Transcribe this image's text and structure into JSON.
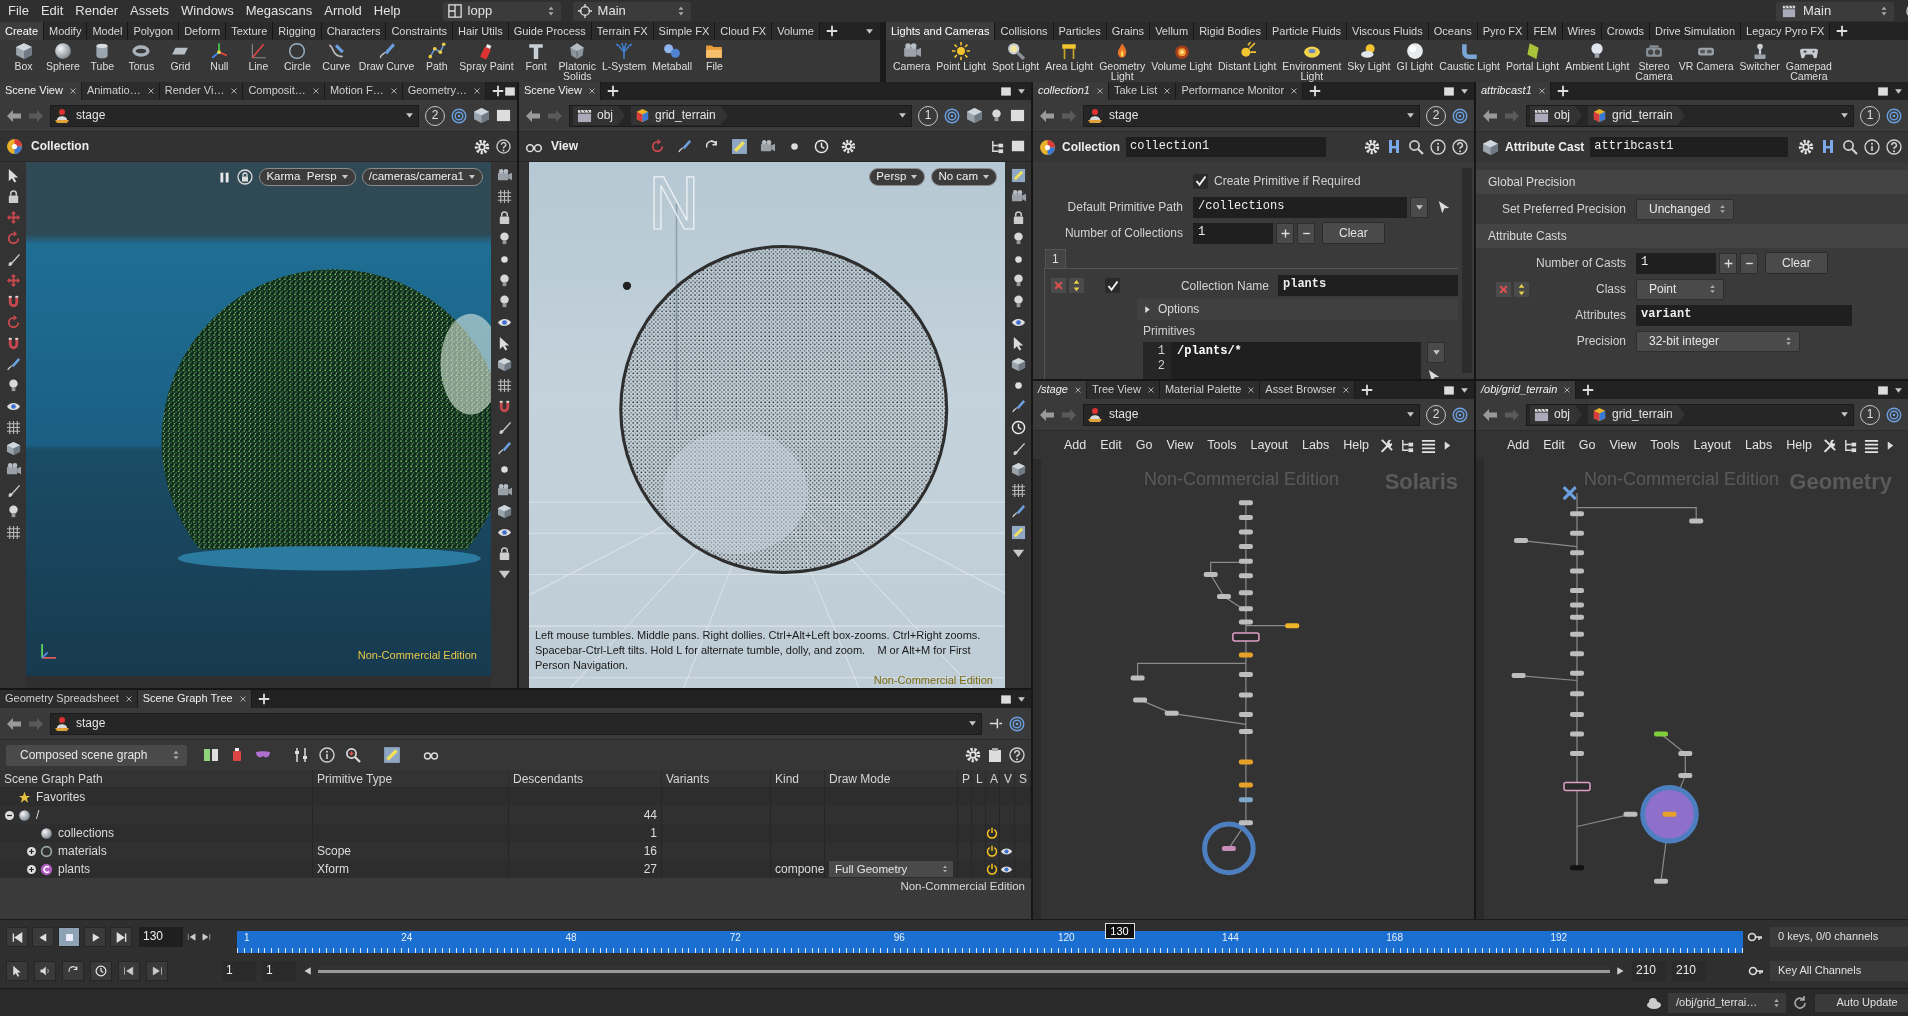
{
  "menu_bar": {
    "menus": [
      "File",
      "Edit",
      "Render",
      "Assets",
      "Windows",
      "Megascans",
      "Arnold",
      "Help"
    ],
    "desktop": "lopp",
    "context": "Main",
    "right_desktop": "Main"
  },
  "shelves": [
    {
      "tabs": [
        {
          "label": "Create",
          "selected": true
        },
        {
          "label": "Modify",
          "selected": false
        },
        {
          "label": "Model",
          "selected": false
        },
        {
          "label": "Polygon",
          "selected": false
        },
        {
          "label": "Deform",
          "selected": false
        },
        {
          "label": "Texture",
          "selected": false
        },
        {
          "label": "Rigging",
          "selected": false
        },
        {
          "label": "Characters",
          "selected": false
        },
        {
          "label": "Constraints",
          "selected": false
        },
        {
          "label": "Hair Utils",
          "selected": false
        },
        {
          "label": "Guide Process",
          "selected": false
        },
        {
          "label": "Terrain FX",
          "selected": false
        },
        {
          "label": "Simple FX",
          "selected": false
        },
        {
          "label": "Cloud FX",
          "selected": false
        },
        {
          "label": "Volume",
          "selected": false
        }
      ],
      "tools": [
        "Box",
        "Sphere",
        "Tube",
        "Torus",
        "Grid",
        "Null",
        "Line",
        "Circle",
        "Curve",
        "Draw Curve",
        "Path",
        "Spray Paint",
        "Font",
        "Platonic\nSolids",
        "L-System",
        "Metaball",
        "File"
      ]
    },
    {
      "tabs": [
        {
          "label": "Lights and Cameras",
          "selected": true
        },
        {
          "label": "Collisions",
          "selected": false
        },
        {
          "label": "Particles",
          "selected": false
        },
        {
          "label": "Grains",
          "selected": false
        },
        {
          "label": "Vellum",
          "selected": false
        },
        {
          "label": "Rigid Bodies",
          "selected": false
        },
        {
          "label": "Particle Fluids",
          "selected": false
        },
        {
          "label": "Viscous Fluids",
          "selected": false
        },
        {
          "label": "Oceans",
          "selected": false
        },
        {
          "label": "Pyro FX",
          "selected": false
        },
        {
          "label": "FEM",
          "selected": false
        },
        {
          "label": "Wires",
          "selected": false
        },
        {
          "label": "Crowds",
          "selected": false
        },
        {
          "label": "Drive Simulation",
          "selected": false
        },
        {
          "label": "Legacy Pyro FX",
          "selected": false
        }
      ],
      "tools": [
        "Camera",
        "Point Light",
        "Spot Light",
        "Area Light",
        "Geometry\nLight",
        "Volume Light",
        "Distant Light",
        "Environment\nLight",
        "Sky Light",
        "GI Light",
        "Caustic Light",
        "Portal Light",
        "Ambient Light",
        "Stereo\nCamera",
        "VR Camera",
        "Switcher",
        "Gamepad\nCamera"
      ]
    }
  ],
  "scene_view": {
    "tabs": [
      {
        "label": "Scene View",
        "selected": true
      },
      {
        "label": "Animatio…",
        "selected": false
      },
      {
        "label": "Render Vi…",
        "selected": false
      },
      {
        "label": "Composit…",
        "selected": false
      },
      {
        "label": "Motion F…",
        "selected": false
      },
      {
        "label": "Geometry…",
        "selected": false
      }
    ],
    "network": "stage",
    "pin": "2",
    "title": "Collection",
    "view": "Karma  Persp",
    "camera": "/cameras/camera1",
    "edition": "Non-Commercial Edition"
  },
  "view_panel": {
    "tabs": [
      {
        "label": "Scene View",
        "selected": true
      }
    ],
    "path": [
      "obj",
      "grid_terrain"
    ],
    "pin": "1",
    "title": "View",
    "view": "Persp",
    "camera": "No cam",
    "compass": "N",
    "hint": "Left mouse tumbles. Middle pans. Right dollies. Ctrl+Alt+Left box-zooms. Ctrl+Right zooms. Spacebar-Ctrl-Left tilts. Hold L for alternate tumble, dolly, and zoom.    M or Alt+M for First Person Navigation.",
    "edition": "Non-Commercial Edition"
  },
  "collection_params": {
    "tabs": [
      {
        "label": "collection1",
        "selected": true,
        "linked": true
      },
      {
        "label": "Take List",
        "selected": false,
        "linked": false
      },
      {
        "label": "Performance Monitor",
        "selected": false,
        "linked": false
      }
    ],
    "network": "stage",
    "pin": "2",
    "node_type": "Collection",
    "node_name": "collection1",
    "create_primitive": {
      "label": "Create Primitive if Required",
      "checked": true
    },
    "primitive_path": {
      "label": "Default Primitive Path",
      "value": "/collections"
    },
    "count": {
      "label": "Number of Collections",
      "value": "1",
      "button": "Clear"
    },
    "instance_tabs": [
      {
        "label": "1",
        "selected": true
      }
    ],
    "instance": {
      "enabled": true,
      "name_label": "Collection Name",
      "name": "plants",
      "options": {
        "label": "Options",
        "expanded": false
      },
      "primitives_label": "Primitives",
      "lines": [
        {
          "number": "1",
          "text": "/plants/*"
        },
        {
          "number": "2"
        }
      ]
    }
  },
  "attribcast_params": {
    "tabs": [
      {
        "label": "attribcast1",
        "selected": true,
        "linked": true
      }
    ],
    "path": [
      "obj",
      "grid_terrain"
    ],
    "pin": "1",
    "node_type": "Attribute Cast",
    "node_name": "attribcast1",
    "rows": [
      {
        "kind": "section",
        "label": "Global Precision"
      },
      {
        "kind": "menu",
        "label": "Set Preferred Precision",
        "value": "Unchanged"
      },
      {
        "kind": "section",
        "label": "Attribute Casts"
      },
      {
        "kind": "count",
        "label": "Number of Casts",
        "value": "1",
        "button": "Clear"
      },
      {
        "kind": "menu",
        "label": "Class",
        "value": "Point",
        "instance_start": true
      },
      {
        "kind": "text",
        "label": "Attributes",
        "value": "variant"
      },
      {
        "kind": "menu",
        "label": "Precision",
        "value": "32-bit integer"
      }
    ]
  },
  "stage_network": {
    "tabs": [
      {
        "label": "/stage",
        "selected": true,
        "linked": true
      },
      {
        "label": "Tree View",
        "selected": false,
        "linked": false
      },
      {
        "label": "Material Palette",
        "selected": false,
        "linked": false
      },
      {
        "label": "Asset Browser",
        "selected": false,
        "linked": false
      }
    ],
    "network": "stage",
    "pin": "2",
    "menus": [
      "Add",
      "Edit",
      "Go",
      "View",
      "Tools",
      "Layout",
      "Labs",
      "Help"
    ],
    "edition": "Non-Commercial Edition",
    "context": "Solaris"
  },
  "geometry_network": {
    "tabs": [
      {
        "label": "/obj/grid_terrain",
        "selected": true,
        "linked": true
      }
    ],
    "path": [
      "obj",
      "grid_terrain"
    ],
    "pin": "1",
    "menus": [
      "Add",
      "Edit",
      "Go",
      "View",
      "Tools",
      "Layout",
      "Labs",
      "Help"
    ],
    "edition": "Non-Commercial Edition",
    "context": "Geometry"
  },
  "scene_graph": {
    "tabs": [
      {
        "label": "Geometry Spreadsheet",
        "selected": false
      },
      {
        "label": "Scene Graph Tree",
        "selected": true
      }
    ],
    "network": "stage",
    "mode": "Composed scene graph",
    "columns": [
      "Scene Graph Path",
      "Primitive Type",
      "Descendants",
      "Variants",
      "Kind",
      "Draw Mode",
      "P",
      "L",
      "A",
      "V",
      "S"
    ],
    "rows": [
      {
        "path": "Favorites"
      },
      {
        "path": "/",
        "descendants": "44",
        "expanded": true,
        "children": [
          {
            "path": "collections",
            "descendants": "1",
            "active": true,
            "visible": false
          },
          {
            "path": "materials",
            "type": "Scope",
            "descendants": "16",
            "expanded": false,
            "active": true,
            "visible": true
          },
          {
            "path": "plants",
            "type": "Xform",
            "descendants": "27",
            "model_kind": "compone",
            "draw_mode": "Full Geometry",
            "expanded": false,
            "active": true,
            "visible": true
          }
        ]
      }
    ],
    "edition": "Non-Commercial Edition"
  },
  "timeline": {
    "transport": [
      {
        "selected": false
      },
      {
        "selected": false
      },
      {
        "selected": true
      },
      {
        "selected": false
      },
      {
        "selected": false
      }
    ],
    "frame": "130",
    "ticks": [
      "1",
      "24",
      "48",
      "72",
      "96",
      "120",
      "144",
      "168",
      "192"
    ],
    "playhead": {
      "label": "130",
      "level": 0.586
    },
    "keys": "0 keys, 0/0 channels",
    "key_mode": "Key All Channels",
    "start": "1",
    "playback_start": "1",
    "range": {
      "level": 1
    },
    "playback_end": "210",
    "end": "210"
  },
  "status_bar": {
    "path": "/obj/grid_terrai…",
    "update": "Auto Update"
  }
}
